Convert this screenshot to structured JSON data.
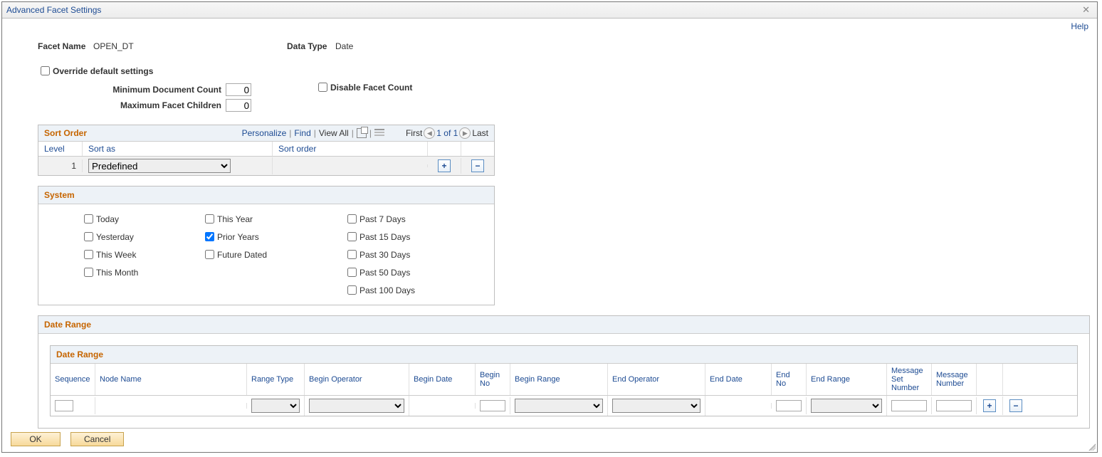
{
  "window": {
    "title": "Advanced Facet Settings",
    "help_label": "Help"
  },
  "fields": {
    "facet_name_label": "Facet Name",
    "facet_name_value": "OPEN_DT",
    "data_type_label": "Data Type",
    "data_type_value": "Date",
    "override_label": "Override default settings",
    "override_checked": false,
    "min_doc_count_label": "Minimum Document Count",
    "min_doc_count_value": "0",
    "max_children_label": "Maximum Facet Children",
    "max_children_value": "0",
    "disable_facet_count_label": "Disable Facet Count",
    "disable_facet_count_checked": false
  },
  "sort": {
    "title": "Sort Order",
    "personalize": "Personalize",
    "find": "Find",
    "view_all": "View All",
    "first": "First",
    "page_info": "1 of 1",
    "last": "Last",
    "cols": {
      "level": "Level",
      "sort_as": "Sort as",
      "sort_order": "Sort order"
    },
    "rows": [
      {
        "level": "1",
        "sort_as": "Predefined",
        "sort_order": ""
      }
    ]
  },
  "system": {
    "title": "System",
    "options": {
      "today": {
        "label": "Today",
        "checked": false
      },
      "yesterday": {
        "label": "Yesterday",
        "checked": false
      },
      "this_week": {
        "label": "This Week",
        "checked": false
      },
      "this_month": {
        "label": "This Month",
        "checked": false
      },
      "this_year": {
        "label": "This Year",
        "checked": false
      },
      "prior_years": {
        "label": "Prior Years",
        "checked": true
      },
      "future_dated": {
        "label": "Future Dated",
        "checked": false
      },
      "past_7": {
        "label": "Past 7 Days",
        "checked": false
      },
      "past_15": {
        "label": "Past 15 Days",
        "checked": false
      },
      "past_30": {
        "label": "Past 30 Days",
        "checked": false
      },
      "past_50": {
        "label": "Past 50 Days",
        "checked": false
      },
      "past_100": {
        "label": "Past 100 Days",
        "checked": false
      }
    }
  },
  "range": {
    "outer_title": "Date Range",
    "inner_title": "Date Range",
    "cols": {
      "sequence": "Sequence",
      "node_name": "Node Name",
      "range_type": "Range Type",
      "begin_operator": "Begin Operator",
      "begin_date": "Begin Date",
      "begin_no": "Begin No",
      "begin_range": "Begin Range",
      "end_operator": "End Operator",
      "end_date": "End Date",
      "end_no": "End No",
      "end_range": "End Range",
      "msg_set": "Message Set Number",
      "msg_num": "Message Number"
    },
    "rows": [
      {
        "sequence": "",
        "node_name": "",
        "range_type": "",
        "begin_operator": "",
        "begin_date": "",
        "begin_no": "",
        "begin_range": "",
        "end_operator": "",
        "end_date": "",
        "end_no": "",
        "end_range": "",
        "msg_set": "",
        "msg_num": ""
      }
    ]
  },
  "buttons": {
    "ok": "OK",
    "cancel": "Cancel"
  }
}
